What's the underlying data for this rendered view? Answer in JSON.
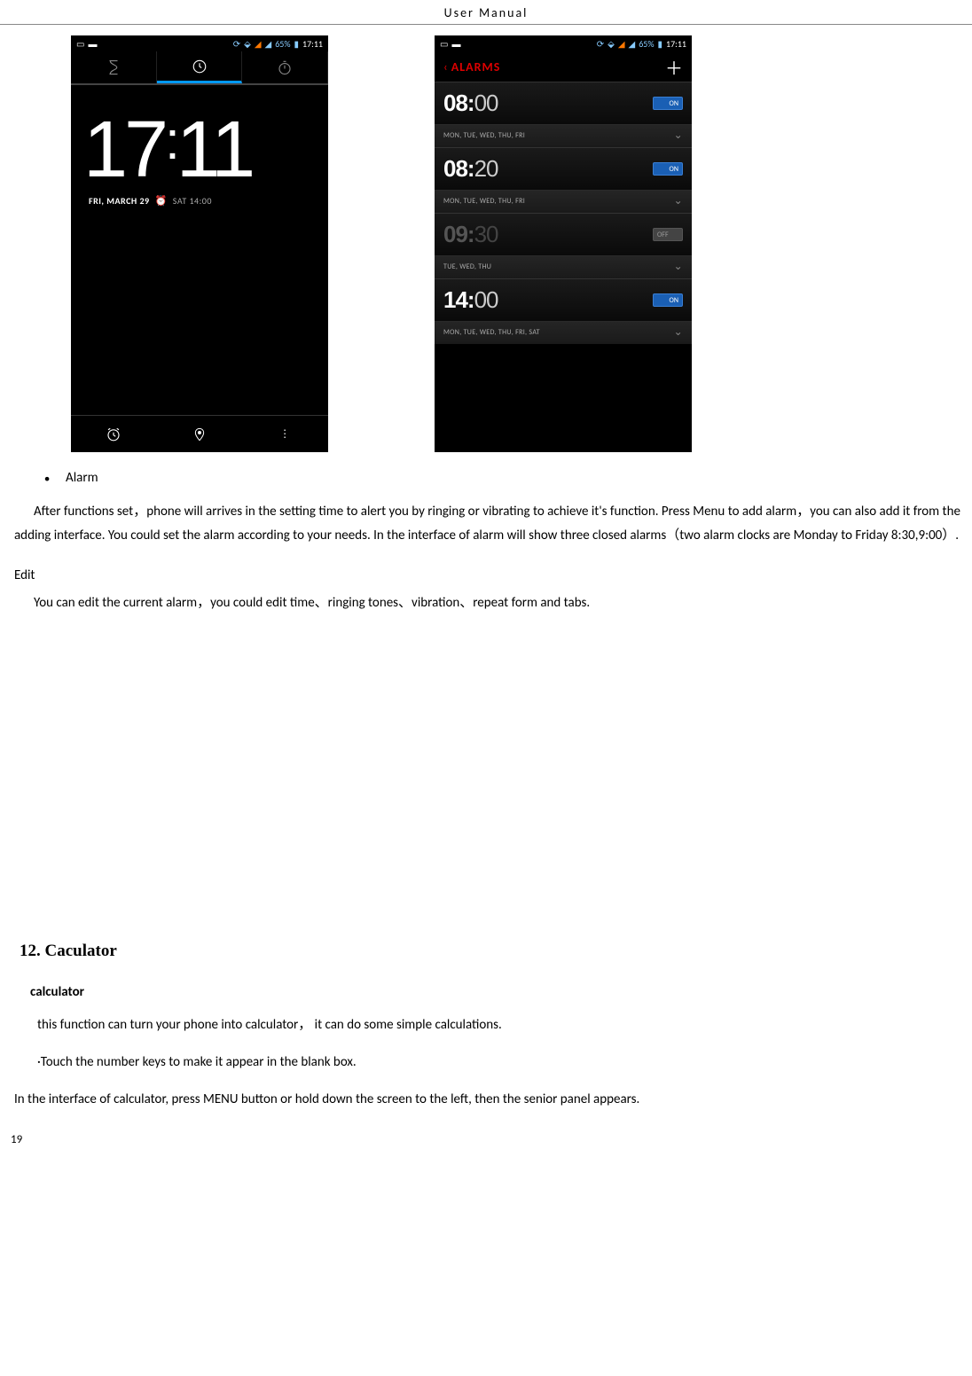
{
  "header": "User    Manual",
  "statusbar": {
    "battery": "65%",
    "time": "17:11"
  },
  "clock": {
    "time_h": "17",
    "time_m": "11",
    "date": "FRI, MARCH 29",
    "next": "SAT 14:00"
  },
  "alarms_screen": {
    "title": "ALARMS",
    "items": [
      {
        "h": "08",
        "m": "00",
        "days": "MON, TUE, WED, THU, FRI",
        "state": "ON"
      },
      {
        "h": "08",
        "m": "20",
        "days": "MON, TUE, WED, THU, FRI",
        "state": "ON"
      },
      {
        "h": "09",
        "m": "30",
        "days": "TUE, WED, THU",
        "state": "OFF"
      },
      {
        "h": "14",
        "m": "00",
        "days": "MON, TUE, WED, THU, FRI, SAT",
        "state": "ON"
      }
    ]
  },
  "doc": {
    "bullet_alarm": "Alarm",
    "p1": "After functions set，phone will arrives in the setting time to alert you by ringing or vibrating to achieve it's function. Press Menu to add alarm，you can also add it from the adding interface. You could set the alarm according to your needs. In the interface of alarm will show three closed alarms（two alarm clocks are Monday to Friday 8:30,9:00）.",
    "edit_label": "Edit",
    "p2": "You can edit the current alarm，you could edit time、ringing tones、vibration、repeat form and tabs.",
    "sec12": "12. Caculator",
    "calc_title": "calculator",
    "calc_p1": "this function can turn your phone into calculator，   it can do some simple calculations.",
    "calc_p2": "·Touch the number keys to make it appear in the blank box.",
    "calc_p3": "In the interface of calculator, press MENU button or hold down the screen to the left, then the senior panel appears.",
    "pagenum": "19"
  }
}
